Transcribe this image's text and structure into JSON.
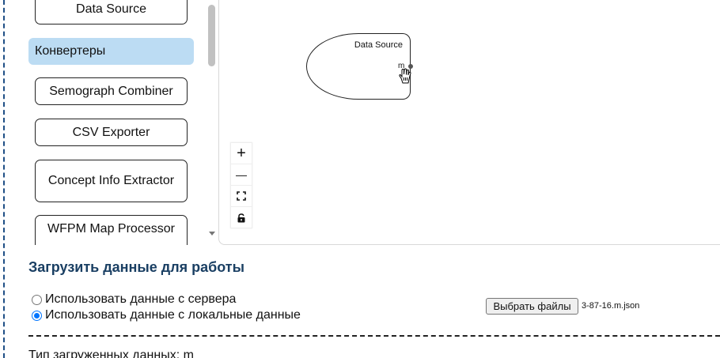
{
  "palette": {
    "items_top": "Data Source",
    "category": "Конвертеры",
    "items": [
      "Semograph Combiner",
      "CSV Exporter",
      "Concept Info Extractor",
      "WFPM Map Processor"
    ]
  },
  "canvas": {
    "node": {
      "title": "Data Source",
      "port_label": "m"
    },
    "controls": {
      "zoom_in": "+",
      "zoom_out": "—"
    }
  },
  "form": {
    "section_title": "Загрузить данные для работы",
    "radio_server": "Использовать данные с сервера",
    "radio_local": "Использовать данные с локальные данные",
    "file_button": "Выбрать файлы",
    "file_name": "3-87-16.m.json",
    "data_type": "Тип загруженных данных: m"
  },
  "colors": {
    "category_bg": "#bcdcf3",
    "title": "#1a3f63",
    "frame": "#1f4f86",
    "radio_accent": "#0075ff"
  }
}
